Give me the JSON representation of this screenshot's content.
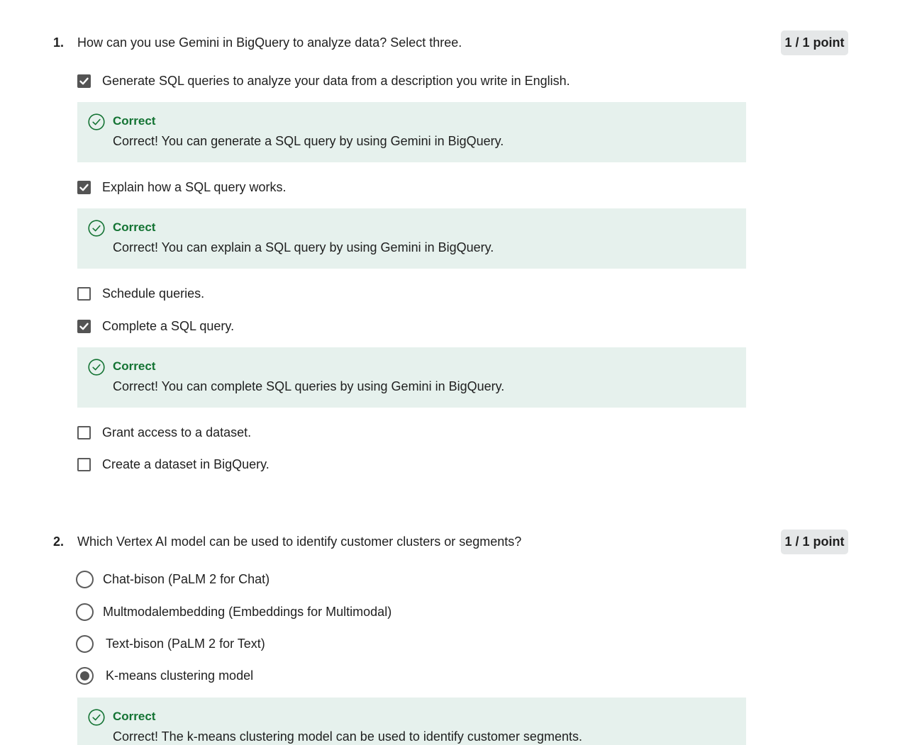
{
  "q1": {
    "number": "1.",
    "text": "How can you use Gemini in BigQuery to analyze data? Select three.",
    "points": "1 / 1 point",
    "options": [
      {
        "label": "Generate SQL queries to analyze your data from a description you write in English.",
        "checked": true
      },
      {
        "label": "Explain how a SQL query works.",
        "checked": true
      },
      {
        "label": "Schedule queries.",
        "checked": false
      },
      {
        "label": "Complete a SQL query.",
        "checked": true
      },
      {
        "label": "Grant access to a dataset.",
        "checked": false
      },
      {
        "label": "Create a dataset in BigQuery.",
        "checked": false
      }
    ],
    "feedback": [
      {
        "title": "Correct",
        "text": "Correct! You can generate a SQL query by using Gemini in BigQuery."
      },
      {
        "title": "Correct",
        "text": "Correct! You can explain a SQL query by using Gemini in BigQuery."
      },
      {
        "title": "Correct",
        "text": "Correct! You can complete SQL queries by using Gemini in BigQuery."
      }
    ]
  },
  "q2": {
    "number": "2.",
    "text": "Which Vertex AI model can be used to identify customer clusters or segments?",
    "points": "1 / 1 point",
    "options": [
      {
        "label": "Chat-bison (PaLM 2 for Chat)",
        "selected": false
      },
      {
        "label": "Multmodalembedding (Embeddings for Multimodal)",
        "selected": false
      },
      {
        "label": "Text-bison (PaLM 2 for Text)",
        "selected": false
      },
      {
        "label": "K-means clustering model",
        "selected": true
      }
    ],
    "feedback": [
      {
        "title": "Correct",
        "text": "Correct! The k-means clustering model can be used to identify customer segments."
      }
    ]
  },
  "colors": {
    "correct_green": "#137333",
    "feedback_bg": "#e6f1ed",
    "control_gray": "#545454",
    "points_bg": "#e5e7e8"
  },
  "icons": {
    "check": "checkmark-icon",
    "correct": "check-circle-icon"
  }
}
